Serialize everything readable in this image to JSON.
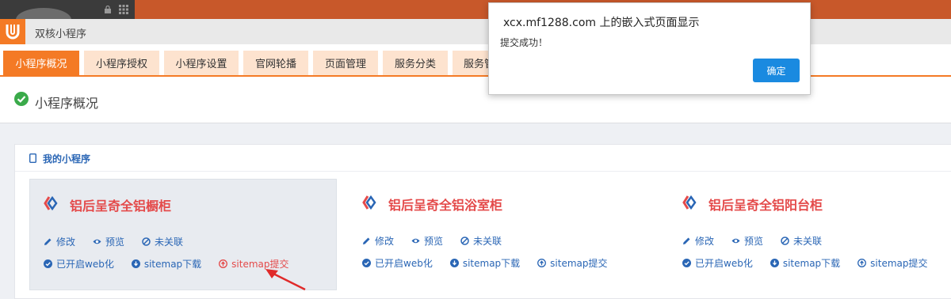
{
  "app": {
    "title": "双核小程序"
  },
  "tabs": [
    {
      "label": "小程序概况",
      "active": true
    },
    {
      "label": "小程序授权"
    },
    {
      "label": "小程序设置"
    },
    {
      "label": "官网轮播"
    },
    {
      "label": "页面管理"
    },
    {
      "label": "服务分类"
    },
    {
      "label": "服务管"
    }
  ],
  "page": {
    "title": "小程序概况"
  },
  "panel": {
    "title": "我的小程序"
  },
  "cards": [
    {
      "name": "铝后呈奇全铝橱柜",
      "edit": "修改",
      "preview": "预览",
      "link": "未关联",
      "web": "已开启web化",
      "sitemap_download": "sitemap下载",
      "sitemap_submit": "sitemap提交"
    },
    {
      "name": "铝后呈奇全铝浴室柜",
      "edit": "修改",
      "preview": "预览",
      "link": "未关联",
      "web": "已开启web化",
      "sitemap_download": "sitemap下载",
      "sitemap_submit": "sitemap提交"
    },
    {
      "name": "铝后呈奇全铝阳台柜",
      "edit": "修改",
      "preview": "预览",
      "link": "未关联",
      "web": "已开启web化",
      "sitemap_download": "sitemap下载",
      "sitemap_submit": "sitemap提交"
    }
  ],
  "dialog": {
    "title": "xcx.mf1288.com 上的嵌入式页面显示",
    "message": "提交成功！",
    "ok_label": "确定"
  },
  "colors": {
    "accent": "#f47a25",
    "link": "#2a66b5",
    "danger": "#e44a4a",
    "button": "#1a8ae0"
  }
}
